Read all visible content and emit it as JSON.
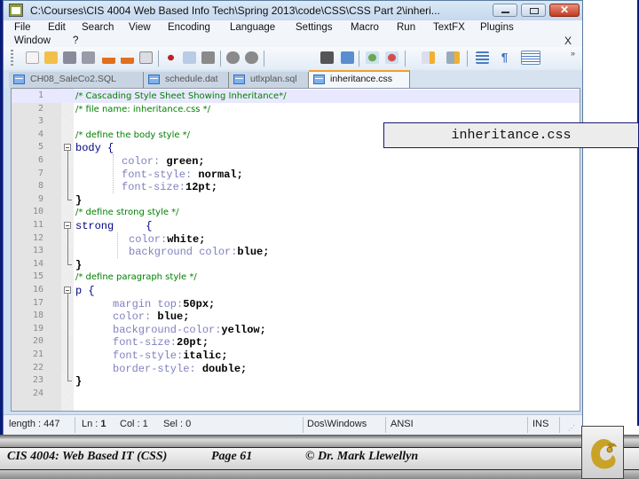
{
  "window": {
    "title": "C:\\Courses\\CIS 4004   Web Based Info Tech\\Spring 2013\\code\\CSS\\CSS   Part 2\\inheri...",
    "controls": {
      "minimize": "minimize",
      "maximize": "maximize",
      "close": "✕"
    }
  },
  "menu": {
    "items": [
      "File",
      "Edit",
      "Search",
      "View",
      "Encoding",
      "Language",
      "Settings",
      "Macro",
      "Run",
      "TextFX",
      "Plugins",
      "Window",
      "?"
    ],
    "close_doc": "X"
  },
  "toolbar": {
    "icons": [
      "new-file-icon",
      "open-file-icon",
      "save-icon",
      "save-all-icon",
      "close-icon",
      "close-all-icon",
      "print-icon",
      "cut-icon",
      "copy-icon",
      "paste-icon",
      "undo-icon",
      "redo-icon",
      "find-icon",
      "replace-icon",
      "zoom-in-icon",
      "zoom-out-icon",
      "sync-vertical-icon",
      "sync-horizontal-icon",
      "word-wrap-icon",
      "show-all-chars-icon",
      "indent-guide-icon"
    ],
    "more": "»"
  },
  "tabs": [
    {
      "label": "CH08_SaleCo2.SQL",
      "active": false
    },
    {
      "label": "schedule.dat",
      "active": false
    },
    {
      "label": "utlxplan.sql",
      "active": false
    },
    {
      "label": "inheritance.css",
      "active": true
    }
  ],
  "code": {
    "lines": [
      {
        "n": "1",
        "type": "comment",
        "text": "/* Cascading Style Sheet Showing Inheritance*/"
      },
      {
        "n": "2",
        "type": "comment",
        "text": "/* file name: inheritance.css */"
      },
      {
        "n": "3",
        "type": "blank",
        "text": ""
      },
      {
        "n": "4",
        "type": "comment",
        "text": "/* define the body style */"
      },
      {
        "n": "5",
        "type": "selector",
        "text": "body {"
      },
      {
        "n": "6",
        "type": "decl",
        "prop": "color: ",
        "val": "green;"
      },
      {
        "n": "7",
        "type": "decl",
        "prop": "font-style: ",
        "val": "normal;"
      },
      {
        "n": "8",
        "type": "decl",
        "prop": "font-size:",
        "val": "12pt;"
      },
      {
        "n": "9",
        "type": "close",
        "text": "}"
      },
      {
        "n": "10",
        "type": "comment",
        "text": "/* define strong style */"
      },
      {
        "n": "11",
        "type": "selector",
        "text": "strong     {"
      },
      {
        "n": "12",
        "type": "decl",
        "prop": "color:",
        "val": "white;"
      },
      {
        "n": "13",
        "type": "decl",
        "prop": "background color:",
        "val": "blue;"
      },
      {
        "n": "14",
        "type": "close",
        "text": "}"
      },
      {
        "n": "15",
        "type": "comment",
        "text": "/* define paragraph style */"
      },
      {
        "n": "16",
        "type": "selector",
        "text": "p {"
      },
      {
        "n": "17",
        "type": "decl",
        "prop": "margin top:",
        "val": "50px;"
      },
      {
        "n": "18",
        "type": "decl",
        "prop": "color: ",
        "val": "blue;"
      },
      {
        "n": "19",
        "type": "decl",
        "prop": "background-color:",
        "val": "yellow;"
      },
      {
        "n": "20",
        "type": "decl",
        "prop": "font-size:",
        "val": "20pt;"
      },
      {
        "n": "21",
        "type": "decl",
        "prop": "font-style:",
        "val": "italic;"
      },
      {
        "n": "22",
        "type": "decl",
        "prop": "border-style: ",
        "val": "double;"
      },
      {
        "n": "23",
        "type": "close",
        "text": "}"
      },
      {
        "n": "24",
        "type": "blank",
        "text": ""
      }
    ]
  },
  "status": {
    "length": "length : 447",
    "ln_label": "Ln : ",
    "ln": "1",
    "col": "Col : 1",
    "sel": "Sel : 0",
    "eol": "Dos\\Windows",
    "encoding": "ANSI",
    "mode": "INS"
  },
  "callout": {
    "label": "inheritance.css"
  },
  "footer": {
    "course": "CIS 4004: Web Based IT (CSS)",
    "page": "Page 61",
    "author": "© Dr. Mark Llewellyn"
  },
  "colors": {
    "comment": "#008000",
    "selector": "#000080",
    "property": "#8080c0",
    "value": "#000000",
    "active_tab_accent": "#f0a030",
    "logo_gold": "#c9a227"
  }
}
